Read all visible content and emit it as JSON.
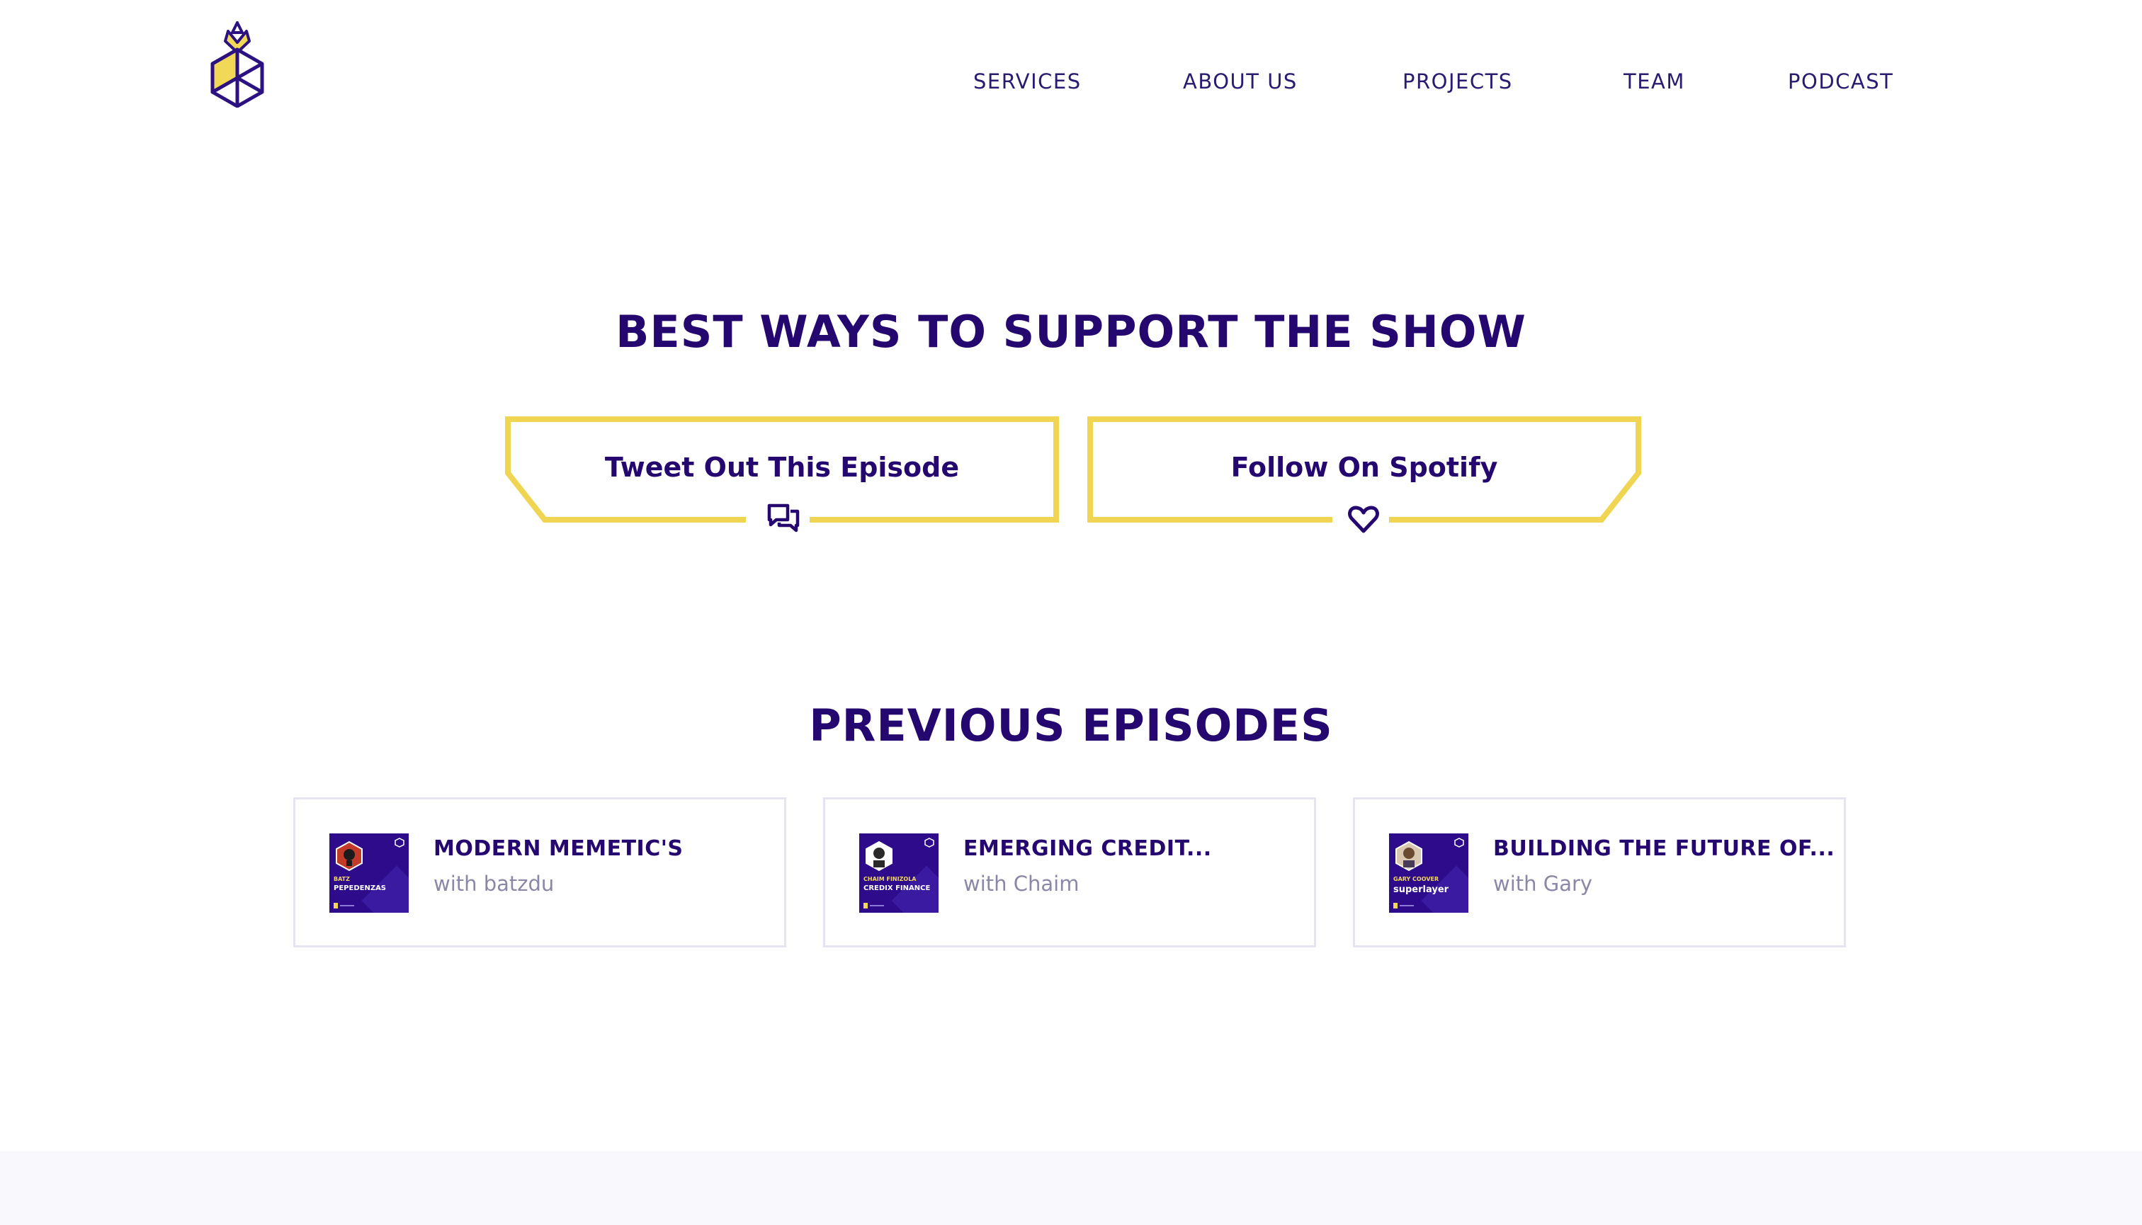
{
  "header": {
    "logo_icon": "pineapple-hexagon-logo",
    "nav": [
      "SERVICES",
      "ABOUT US",
      "PROJECTS",
      "TEAM",
      "PODCAST"
    ]
  },
  "support": {
    "title": "BEST WAYS TO SUPPORT THE SHOW",
    "buttons": [
      {
        "label": "Tweet Out This Episode",
        "icon": "chat-bubbles-icon"
      },
      {
        "label": "Follow On Spotify",
        "icon": "heart-icon"
      }
    ]
  },
  "episodes": {
    "title": "PREVIOUS EPISODES",
    "items": [
      {
        "title": "MODERN MEMETIC'S",
        "guest": "with batzdu",
        "thumb_line1": "BATZ",
        "thumb_line2": "PEPEDENZAS"
      },
      {
        "title": "EMERGING CREDIT...",
        "guest": "with Chaim",
        "thumb_line1": "CHAIM FINIZOLA",
        "thumb_line2": "CREDIX FINANCE"
      },
      {
        "title": "BUILDING THE FUTURE OF...",
        "guest": "with Gary",
        "thumb_line1": "GARY COOVER",
        "thumb_line2": "superlayer"
      }
    ]
  },
  "colors": {
    "brand_purple": "#25086f",
    "accent_yellow": "#f2d857",
    "thumb_bg": "#2d0b8a"
  }
}
